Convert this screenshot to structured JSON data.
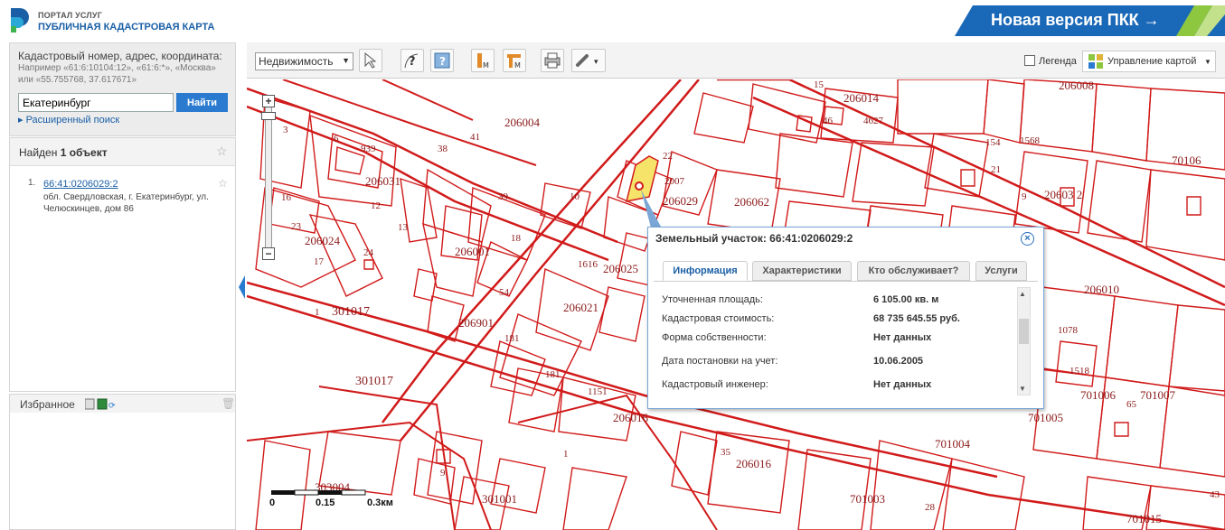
{
  "header": {
    "logo_line1": "ПОРТАЛ УСЛУГ",
    "logo_line2": "ПУБЛИЧНАЯ КАДАСТРОВАЯ КАРТА",
    "new_version": "Новая версия ПКК →"
  },
  "search": {
    "title": "Кадастровый номер, адрес, координата:",
    "example": "Например «61:6:10104:12», «61:6:*», «Москва» или «55.755768, 37.617671»",
    "value": "Екатеринбург",
    "button": "Найти",
    "advanced": "Расширенный поиск"
  },
  "results": {
    "title_prefix": "Найден ",
    "title_count": "1 объект",
    "items": [
      {
        "num": "1.",
        "link": "66:41:0206029:2",
        "address": "обл. Свердловская, г. Екатеринбург, ул. Челюскинцев, дом 86"
      }
    ]
  },
  "favorites": {
    "title": "Избранное"
  },
  "toolbar": {
    "select_value": "Недвижимость",
    "legend": "Легенда",
    "map_control": "Управление картой"
  },
  "popup": {
    "title": "Земельный участок: 66:41:0206029:2",
    "tabs": [
      "Информация",
      "Характеристики",
      "Кто обслуживает?",
      "Услуги"
    ],
    "props": [
      {
        "label": "Уточненная площадь:",
        "value": "6 105.00 кв. м"
      },
      {
        "label": "Кадастровая стоимость:",
        "value": "68 735 645.55 руб."
      },
      {
        "label": "Форма собственности:",
        "value": "Нет данных"
      },
      {
        "label": "Дата постановки на учет:",
        "value": "10.06.2005"
      },
      {
        "label": "Кадастровый инженер:",
        "value": "Нет данных"
      }
    ]
  },
  "scale": {
    "s0": "0",
    "s1": "0.15",
    "s2": "0.3км"
  },
  "map_labels": {
    "b206004": "206004",
    "b206031": "206031",
    "b206024": "206024",
    "b206001": "206001",
    "b301017a": "301017",
    "b301017b": "301017",
    "b206901": "206901",
    "b206014": "206014",
    "b206008": "206008",
    "b206030": "206030",
    "b206029": "206029",
    "b206025": "206025",
    "b206021": "206021",
    "b206016a": "206016",
    "b206016b": "206016",
    "b206010": "206010",
    "b206032": "20603 2",
    "b701004": "701004",
    "b701007": "701007",
    "b701006": "701006",
    "b701005": "701005",
    "b701003": "701003",
    "b701015": "701015",
    "b303004": "303004",
    "b301001": "301001",
    "b206062": "206062",
    "b70106": "70106",
    "n41": "41",
    "n6": "6",
    "n939": "939",
    "n13": "13",
    "n12": "12",
    "n18": "18",
    "n23": "23",
    "n24": "24",
    "n17": "17",
    "n16": "16",
    "n39": "39",
    "n10": "10",
    "n38": "38",
    "n181a": "181",
    "n181b": "181",
    "n1616": "1616",
    "n1a": "1",
    "n1b": "1",
    "n35": "35",
    "n9": "9",
    "n46": "46",
    "n4627": "4627",
    "n15": "15",
    "n2007": "2007",
    "n28": "28",
    "n1078": "1078",
    "n1151": "1151",
    "n54": "54",
    "n1568": "1568",
    "n154": "154",
    "n21": "21",
    "n1518": "1518",
    "n65": "65",
    "n43": "43",
    "n9b": "9",
    "n3": "3",
    "n22": "22"
  },
  "colors": {
    "parcel": "#d11a1a",
    "selected": "#f6e36a",
    "accent": "#2a7bd0"
  }
}
